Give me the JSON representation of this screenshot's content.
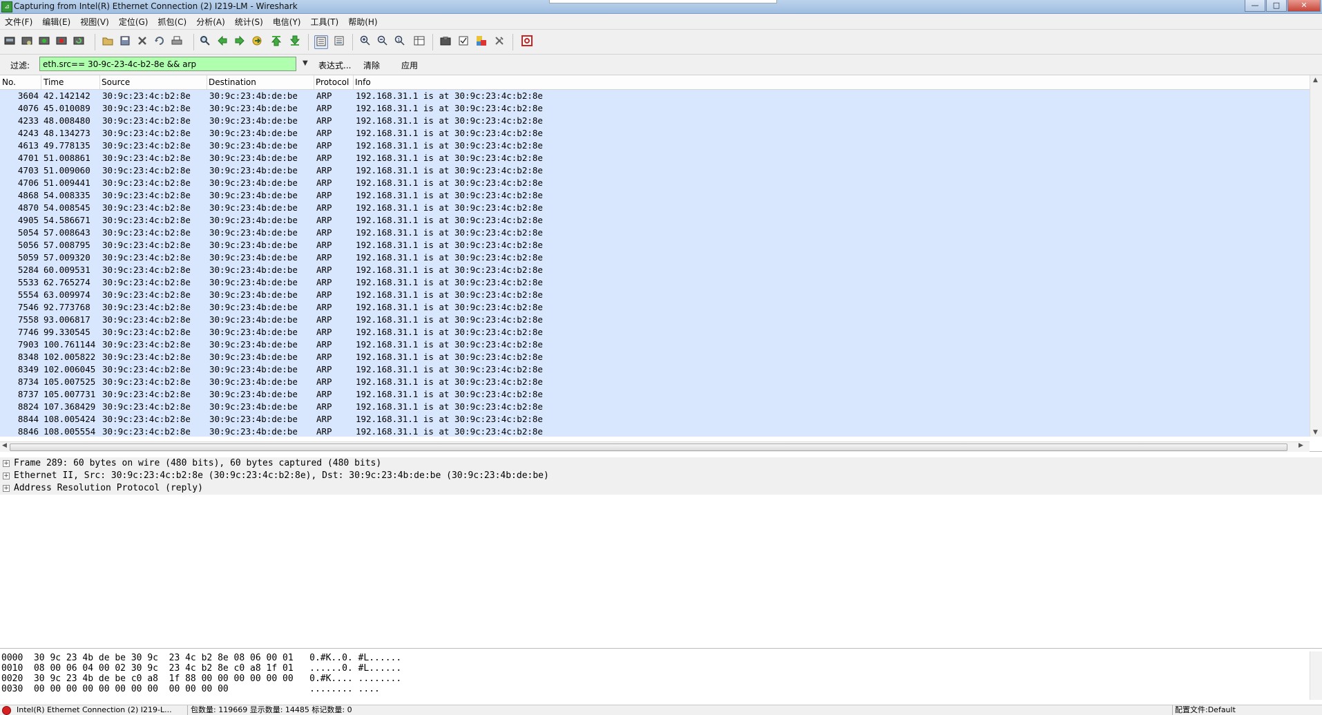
{
  "window": {
    "title": "Capturing from Intel(R) Ethernet Connection (2) I219-LM - Wireshark",
    "minimize": "—",
    "maximize": "□",
    "close": "✕"
  },
  "menu": [
    "文件(F)",
    "编辑(E)",
    "视图(V)",
    "定位(G)",
    "抓包(C)",
    "分析(A)",
    "统计(S)",
    "电信(Y)",
    "工具(T)",
    "帮助(H)"
  ],
  "toolbar": {
    "icons": [
      "interfaces-icon",
      "options-icon",
      "start-icon",
      "stop-icon",
      "restart-icon",
      "open-icon",
      "save-icon",
      "close-file-icon",
      "reload-icon",
      "print-icon",
      "find-icon",
      "back-icon",
      "forward-icon",
      "goto-icon",
      "first-icon",
      "last-icon",
      "autoscroll-icon",
      "colorize-icon",
      "zoom-in-icon",
      "zoom-out-icon",
      "zoom-normal-icon",
      "resize-columns-icon",
      "capture-filters-icon",
      "display-filters-icon",
      "coloring-rules-icon",
      "preferences-icon",
      "help-icon"
    ]
  },
  "filter": {
    "label": "过滤:",
    "value": "eth.src== 30-9c-23-4c-b2-8e && arp",
    "dropdown": "▼",
    "expression": "表达式...",
    "clear": "清除",
    "apply": "应用",
    "color": "#afffaf"
  },
  "columns": [
    "No.",
    "Time",
    "Source",
    "Destination",
    "Protocol",
    "Info"
  ],
  "packets": [
    {
      "no": "3604",
      "time": "42.142142",
      "src": "30:9c:23:4c:b2:8e",
      "dst": "30:9c:23:4b:de:be",
      "proto": "ARP",
      "info": "192.168.31.1 is at 30:9c:23:4c:b2:8e"
    },
    {
      "no": "4076",
      "time": "45.010089",
      "src": "30:9c:23:4c:b2:8e",
      "dst": "30:9c:23:4b:de:be",
      "proto": "ARP",
      "info": "192.168.31.1 is at 30:9c:23:4c:b2:8e"
    },
    {
      "no": "4233",
      "time": "48.008480",
      "src": "30:9c:23:4c:b2:8e",
      "dst": "30:9c:23:4b:de:be",
      "proto": "ARP",
      "info": "192.168.31.1 is at 30:9c:23:4c:b2:8e"
    },
    {
      "no": "4243",
      "time": "48.134273",
      "src": "30:9c:23:4c:b2:8e",
      "dst": "30:9c:23:4b:de:be",
      "proto": "ARP",
      "info": "192.168.31.1 is at 30:9c:23:4c:b2:8e"
    },
    {
      "no": "4613",
      "time": "49.778135",
      "src": "30:9c:23:4c:b2:8e",
      "dst": "30:9c:23:4b:de:be",
      "proto": "ARP",
      "info": "192.168.31.1 is at 30:9c:23:4c:b2:8e"
    },
    {
      "no": "4701",
      "time": "51.008861",
      "src": "30:9c:23:4c:b2:8e",
      "dst": "30:9c:23:4b:de:be",
      "proto": "ARP",
      "info": "192.168.31.1 is at 30:9c:23:4c:b2:8e"
    },
    {
      "no": "4703",
      "time": "51.009060",
      "src": "30:9c:23:4c:b2:8e",
      "dst": "30:9c:23:4b:de:be",
      "proto": "ARP",
      "info": "192.168.31.1 is at 30:9c:23:4c:b2:8e"
    },
    {
      "no": "4706",
      "time": "51.009441",
      "src": "30:9c:23:4c:b2:8e",
      "dst": "30:9c:23:4b:de:be",
      "proto": "ARP",
      "info": "192.168.31.1 is at 30:9c:23:4c:b2:8e"
    },
    {
      "no": "4868",
      "time": "54.008335",
      "src": "30:9c:23:4c:b2:8e",
      "dst": "30:9c:23:4b:de:be",
      "proto": "ARP",
      "info": "192.168.31.1 is at 30:9c:23:4c:b2:8e"
    },
    {
      "no": "4870",
      "time": "54.008545",
      "src": "30:9c:23:4c:b2:8e",
      "dst": "30:9c:23:4b:de:be",
      "proto": "ARP",
      "info": "192.168.31.1 is at 30:9c:23:4c:b2:8e"
    },
    {
      "no": "4905",
      "time": "54.586671",
      "src": "30:9c:23:4c:b2:8e",
      "dst": "30:9c:23:4b:de:be",
      "proto": "ARP",
      "info": "192.168.31.1 is at 30:9c:23:4c:b2:8e"
    },
    {
      "no": "5054",
      "time": "57.008643",
      "src": "30:9c:23:4c:b2:8e",
      "dst": "30:9c:23:4b:de:be",
      "proto": "ARP",
      "info": "192.168.31.1 is at 30:9c:23:4c:b2:8e"
    },
    {
      "no": "5056",
      "time": "57.008795",
      "src": "30:9c:23:4c:b2:8e",
      "dst": "30:9c:23:4b:de:be",
      "proto": "ARP",
      "info": "192.168.31.1 is at 30:9c:23:4c:b2:8e"
    },
    {
      "no": "5059",
      "time": "57.009320",
      "src": "30:9c:23:4c:b2:8e",
      "dst": "30:9c:23:4b:de:be",
      "proto": "ARP",
      "info": "192.168.31.1 is at 30:9c:23:4c:b2:8e"
    },
    {
      "no": "5284",
      "time": "60.009531",
      "src": "30:9c:23:4c:b2:8e",
      "dst": "30:9c:23:4b:de:be",
      "proto": "ARP",
      "info": "192.168.31.1 is at 30:9c:23:4c:b2:8e"
    },
    {
      "no": "5533",
      "time": "62.765274",
      "src": "30:9c:23:4c:b2:8e",
      "dst": "30:9c:23:4b:de:be",
      "proto": "ARP",
      "info": "192.168.31.1 is at 30:9c:23:4c:b2:8e"
    },
    {
      "no": "5554",
      "time": "63.009974",
      "src": "30:9c:23:4c:b2:8e",
      "dst": "30:9c:23:4b:de:be",
      "proto": "ARP",
      "info": "192.168.31.1 is at 30:9c:23:4c:b2:8e"
    },
    {
      "no": "7546",
      "time": "92.773768",
      "src": "30:9c:23:4c:b2:8e",
      "dst": "30:9c:23:4b:de:be",
      "proto": "ARP",
      "info": "192.168.31.1 is at 30:9c:23:4c:b2:8e"
    },
    {
      "no": "7558",
      "time": "93.006817",
      "src": "30:9c:23:4c:b2:8e",
      "dst": "30:9c:23:4b:de:be",
      "proto": "ARP",
      "info": "192.168.31.1 is at 30:9c:23:4c:b2:8e"
    },
    {
      "no": "7746",
      "time": "99.330545",
      "src": "30:9c:23:4c:b2:8e",
      "dst": "30:9c:23:4b:de:be",
      "proto": "ARP",
      "info": "192.168.31.1 is at 30:9c:23:4c:b2:8e"
    },
    {
      "no": "7903",
      "time": "100.761144",
      "src": "30:9c:23:4c:b2:8e",
      "dst": "30:9c:23:4b:de:be",
      "proto": "ARP",
      "info": "192.168.31.1 is at 30:9c:23:4c:b2:8e"
    },
    {
      "no": "8348",
      "time": "102.005822",
      "src": "30:9c:23:4c:b2:8e",
      "dst": "30:9c:23:4b:de:be",
      "proto": "ARP",
      "info": "192.168.31.1 is at 30:9c:23:4c:b2:8e"
    },
    {
      "no": "8349",
      "time": "102.006045",
      "src": "30:9c:23:4c:b2:8e",
      "dst": "30:9c:23:4b:de:be",
      "proto": "ARP",
      "info": "192.168.31.1 is at 30:9c:23:4c:b2:8e"
    },
    {
      "no": "8734",
      "time": "105.007525",
      "src": "30:9c:23:4c:b2:8e",
      "dst": "30:9c:23:4b:de:be",
      "proto": "ARP",
      "info": "192.168.31.1 is at 30:9c:23:4c:b2:8e"
    },
    {
      "no": "8737",
      "time": "105.007731",
      "src": "30:9c:23:4c:b2:8e",
      "dst": "30:9c:23:4b:de:be",
      "proto": "ARP",
      "info": "192.168.31.1 is at 30:9c:23:4c:b2:8e"
    },
    {
      "no": "8824",
      "time": "107.368429",
      "src": "30:9c:23:4c:b2:8e",
      "dst": "30:9c:23:4b:de:be",
      "proto": "ARP",
      "info": "192.168.31.1 is at 30:9c:23:4c:b2:8e"
    },
    {
      "no": "8844",
      "time": "108.005424",
      "src": "30:9c:23:4c:b2:8e",
      "dst": "30:9c:23:4b:de:be",
      "proto": "ARP",
      "info": "192.168.31.1 is at 30:9c:23:4c:b2:8e"
    },
    {
      "no": "8846",
      "time": "108.005554",
      "src": "30:9c:23:4c:b2:8e",
      "dst": "30:9c:23:4b:de:be",
      "proto": "ARP",
      "info": "192.168.31.1 is at 30:9c:23:4c:b2:8e"
    }
  ],
  "row_color": "#d8e7fd",
  "details": [
    "Frame 289: 60 bytes on wire (480 bits), 60 bytes captured (480 bits)",
    "Ethernet II, Src: 30:9c:23:4c:b2:8e (30:9c:23:4c:b2:8e), Dst: 30:9c:23:4b:de:be (30:9c:23:4b:de:be)",
    "Address Resolution Protocol (reply)"
  ],
  "hex": [
    "0000  30 9c 23 4b de be 30 9c  23 4c b2 8e 08 06 00 01   0.#K..0. #L......",
    "0010  08 00 06 04 00 02 30 9c  23 4c b2 8e c0 a8 1f 01   ......0. #L......",
    "0020  30 9c 23 4b de be c0 a8  1f 88 00 00 00 00 00 00   0.#K.... ........",
    "0030  00 00 00 00 00 00 00 00  00 00 00 00               ........ ...."
  ],
  "status": {
    "interface": "Intel(R) Ethernet Connection (2) I219-L...",
    "counts": "包数量: 119669 显示数量: 14485 标记数量: 0",
    "profile": "配置文件:Default"
  }
}
